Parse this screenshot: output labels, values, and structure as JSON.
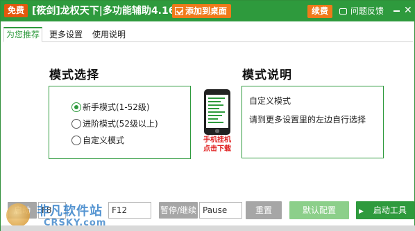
{
  "titlebar": {
    "free_badge": "免费",
    "app_title": "[筱剑]龙权天下|多功能辅助4.16",
    "add_to_desktop": "添加到桌面",
    "renew": "续费",
    "feedback": "问题反馈",
    "minimize_glyph": "—",
    "close_glyph": "✕"
  },
  "tabs": [
    "为您推荐",
    "更多设置",
    "使用说明"
  ],
  "mode_select": {
    "heading": "模式选择",
    "options": [
      {
        "label": "新手模式(1-52级)",
        "selected": true
      },
      {
        "label": "进阶模式(52级以上)",
        "selected": false
      },
      {
        "label": "自定义模式",
        "selected": false
      }
    ]
  },
  "phone_promo": {
    "line1": "手机挂机",
    "line2": "点击下载"
  },
  "mode_desc": {
    "heading": "模式说明",
    "line1": "自定义模式",
    "line2": "请到更多设置里的左边自行选择"
  },
  "bottom": {
    "start_label": "启动",
    "start_key": "F8",
    "second_key": "F12",
    "pause_label": "暂停/继续",
    "pause_key": "Pause",
    "reset": "重置",
    "default_config": "默认配置",
    "start_tool": "启动工具",
    "play_glyph": "▶"
  },
  "watermark": {
    "cn": "非凡软件站",
    "en": "CRSKY.com"
  },
  "colors": {
    "brand_green": "#2e9a3d",
    "orange": "#f07a1a",
    "alert_red": "#e02020"
  }
}
